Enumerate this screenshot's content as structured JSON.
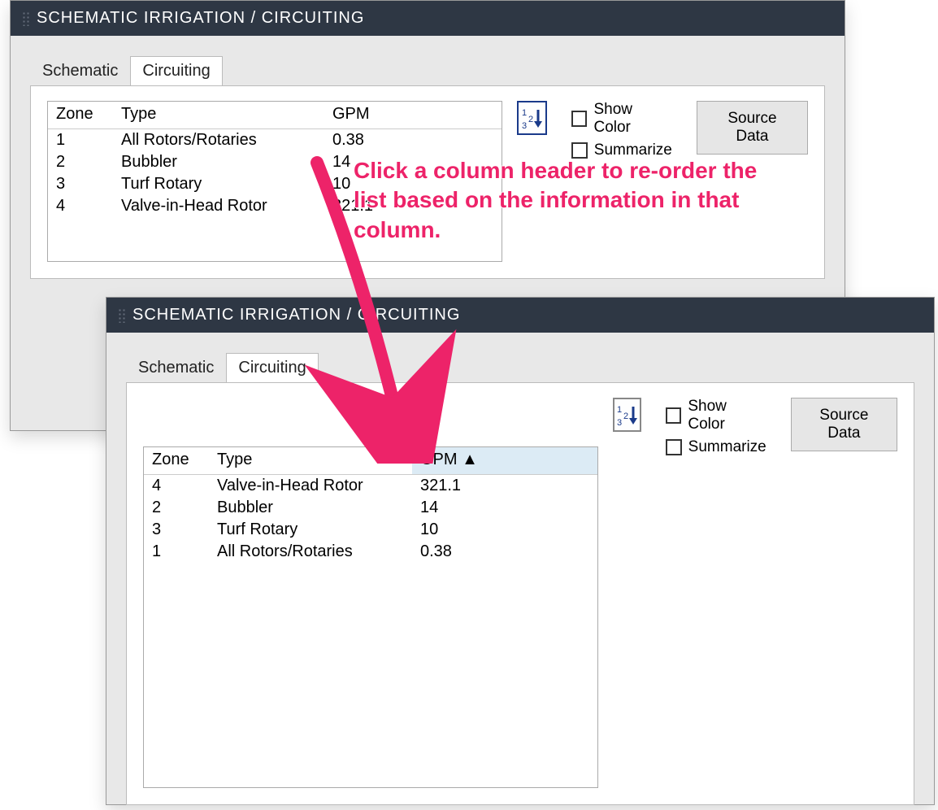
{
  "panel1": {
    "title": "SCHEMATIC IRRIGATION / CIRCUITING",
    "tabs": {
      "schematic": "Schematic",
      "circuiting": "Circuiting"
    },
    "checks": {
      "show_color": "Show Color",
      "summarize": "Summarize"
    },
    "source_btn": "Source Data",
    "columns": {
      "zone": "Zone",
      "type": "Type",
      "gpm": "GPM"
    },
    "rows": [
      {
        "zone": "1",
        "type": "All Rotors/Rotaries",
        "gpm": "0.38"
      },
      {
        "zone": "2",
        "type": "Bubbler",
        "gpm": "14"
      },
      {
        "zone": "3",
        "type": "Turf Rotary",
        "gpm": "10"
      },
      {
        "zone": "4",
        "type": "Valve-in-Head Rotor",
        "gpm": "321.1"
      }
    ]
  },
  "panel2": {
    "title": "SCHEMATIC IRRIGATION / CIRCUITING",
    "tabs": {
      "schematic": "Schematic",
      "circuiting": "Circuiting"
    },
    "checks": {
      "show_color": "Show Color",
      "summarize": "Summarize"
    },
    "source_btn": "Source Data",
    "columns": {
      "zone": "Zone",
      "type": "Type",
      "gpm": "GPM ▲"
    },
    "rows": [
      {
        "zone": "4",
        "type": "Valve-in-Head Rotor",
        "gpm": "321.1"
      },
      {
        "zone": "2",
        "type": "Bubbler",
        "gpm": "14"
      },
      {
        "zone": "3",
        "type": "Turf Rotary",
        "gpm": "10"
      },
      {
        "zone": "1",
        "type": "All Rotors/Rotaries",
        "gpm": "0.38"
      }
    ]
  },
  "callout": "Click a column header to re-order the list based on the information in that column."
}
